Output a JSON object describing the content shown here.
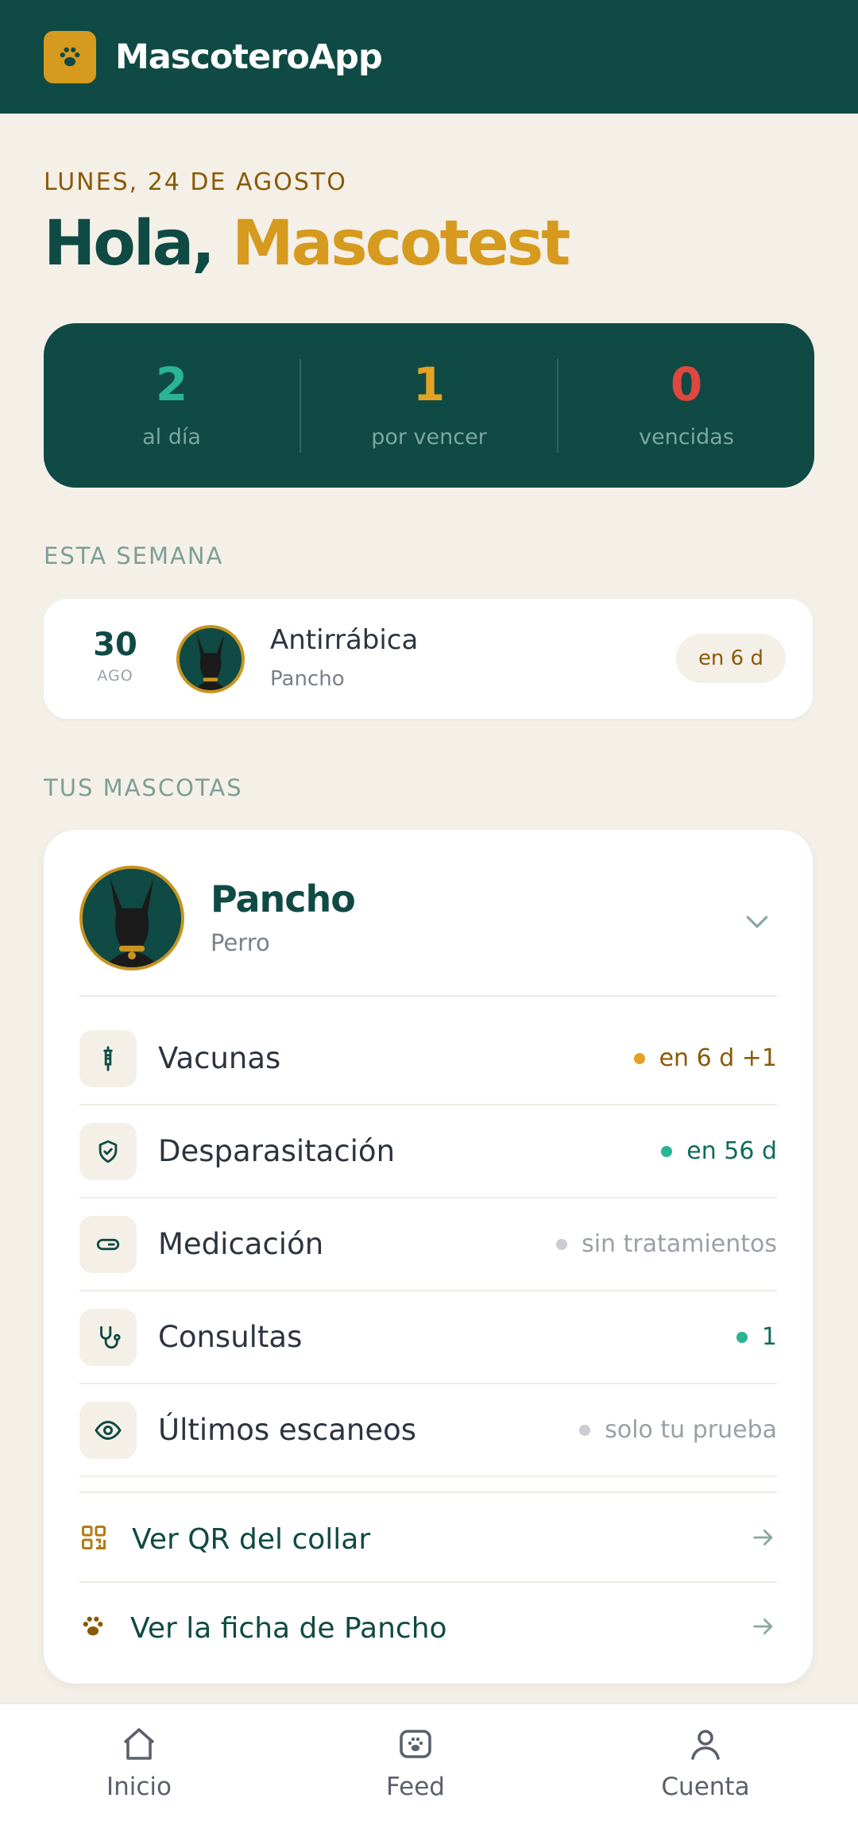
{
  "app": {
    "title": "MascoteroApp",
    "logo_icon": "paw-icon"
  },
  "header": {
    "date": "LUNES, 24 DE AGOSTO",
    "greeting_prefix": "Hola,",
    "greeting_name": "Mascotest"
  },
  "stats": [
    {
      "value": "2",
      "label": "al día",
      "color": "#2bb395"
    },
    {
      "value": "1",
      "label": "por vencer",
      "color": "#e3a224"
    },
    {
      "value": "0",
      "label": "vencidas",
      "color": "#e0473f"
    }
  ],
  "week": {
    "section_label": "ESTA SEMANA",
    "event": {
      "day": "30",
      "month": "AGO",
      "title": "Antirrábica",
      "pet": "Pancho",
      "badge": "en 6 d"
    }
  },
  "pets": {
    "section_label": "TUS MASCOTAS",
    "pet": {
      "name": "Pancho",
      "species": "Perro"
    },
    "rows": [
      {
        "icon": "syringe-icon",
        "label": "Vacunas",
        "status": "en 6 d +1",
        "dot_color": "#e3a224",
        "text_color": "#8a5a08"
      },
      {
        "icon": "shield-check-icon",
        "label": "Desparasitación",
        "status": "en 56 d",
        "dot_color": "#2bb395",
        "text_color": "#0f6b5e"
      },
      {
        "icon": "pill-icon",
        "label": "Medicación",
        "status": "sin tratamientos",
        "dot_color": "#c9ccd1",
        "text_color": "#9aa0a6"
      },
      {
        "icon": "stethoscope-icon",
        "label": "Consultas",
        "status": "1",
        "dot_color": "#2bb395",
        "text_color": "#0f6b5e"
      },
      {
        "icon": "eye-icon",
        "label": "Últimos escaneos",
        "status": "solo tu prueba",
        "dot_color": "#c9ccd1",
        "text_color": "#9aa0a6"
      }
    ],
    "links": [
      {
        "icon": "qr-code-icon",
        "label": "Ver QR del collar"
      },
      {
        "icon": "paw-icon",
        "label": "Ver la ficha de Pancho"
      }
    ]
  },
  "nav": [
    {
      "icon": "home-icon",
      "label": "Inicio"
    },
    {
      "icon": "feed-icon",
      "label": "Feed"
    },
    {
      "icon": "user-icon",
      "label": "Cuenta"
    }
  ]
}
